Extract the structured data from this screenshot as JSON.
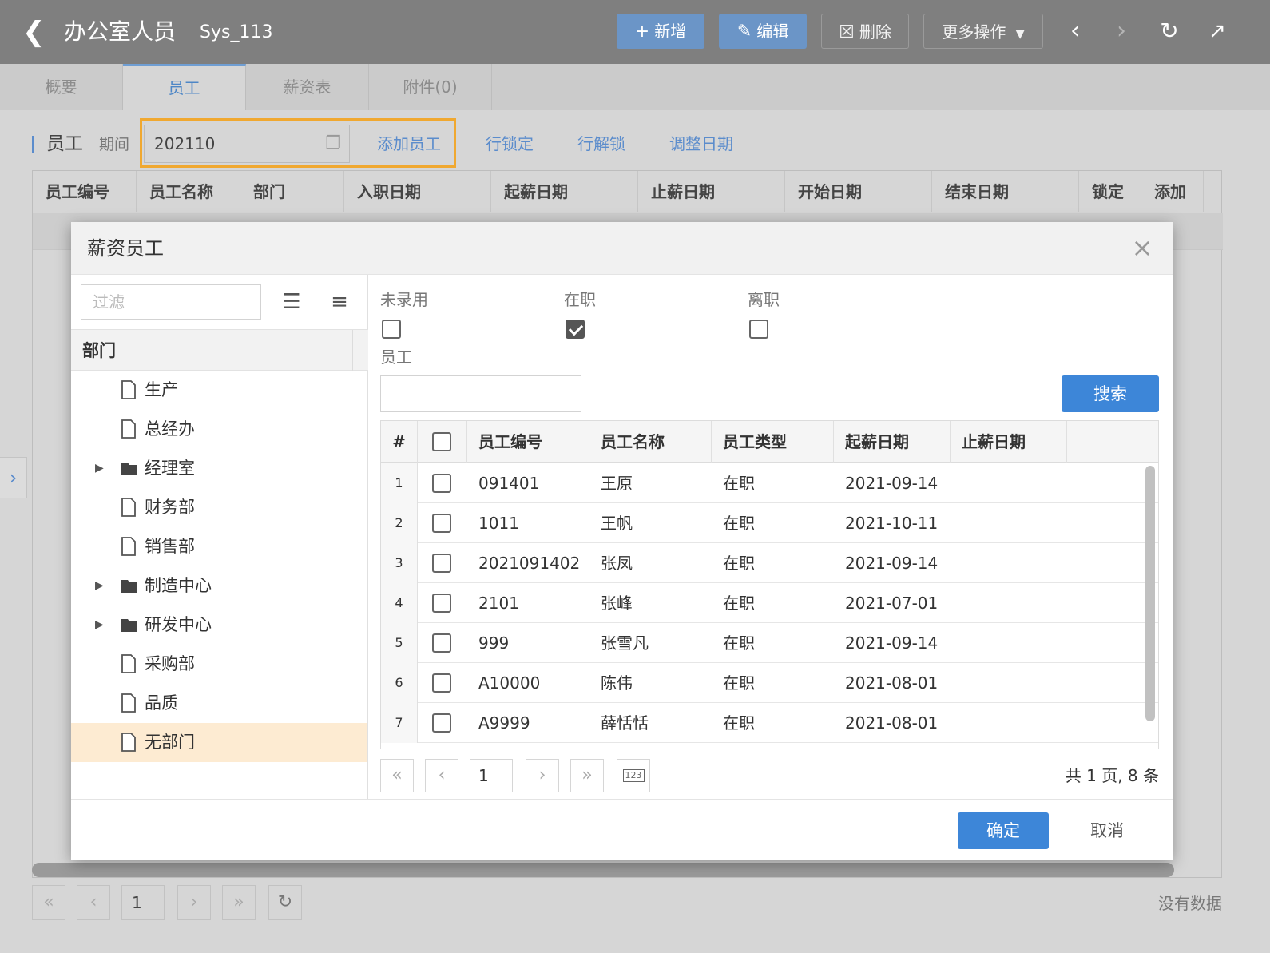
{
  "topbar": {
    "back_icon": "chevron-left-icon",
    "title": "办公室人员",
    "sys_id": "Sys_113",
    "buttons": {
      "add": "新增",
      "edit": "编辑",
      "delete": "删除",
      "more": "更多操作"
    }
  },
  "tabs": [
    {
      "label": "概要"
    },
    {
      "label": "员工",
      "active": true
    },
    {
      "label": "薪资表"
    },
    {
      "label": "附件(0)"
    }
  ],
  "toolbar": {
    "section": "员工",
    "period_label": "期间",
    "period_value": "202110",
    "links": [
      "添加员工",
      "行锁定",
      "行解锁",
      "调整日期"
    ]
  },
  "bg_table": {
    "columns": [
      "员工编号",
      "员工名称",
      "部门",
      "入职日期",
      "起薪日期",
      "止薪日期",
      "开始日期",
      "结束日期",
      "锁定",
      "添加"
    ]
  },
  "bg_pager": {
    "page": "1",
    "status": "没有数据"
  },
  "modal": {
    "title": "薪资员工",
    "filter_placeholder": "过滤",
    "tree_header": "部门",
    "tree": [
      {
        "label": "生产",
        "type": "file"
      },
      {
        "label": "总经办",
        "type": "file"
      },
      {
        "label": "经理室",
        "type": "folder"
      },
      {
        "label": "财务部",
        "type": "file"
      },
      {
        "label": "销售部",
        "type": "file"
      },
      {
        "label": "制造中心",
        "type": "folder"
      },
      {
        "label": "研发中心",
        "type": "folder"
      },
      {
        "label": "采购部",
        "type": "file"
      },
      {
        "label": "品质",
        "type": "file"
      },
      {
        "label": "无部门",
        "type": "file",
        "selected": true
      }
    ],
    "filters": {
      "unhired": {
        "label": "未录用",
        "checked": false
      },
      "active": {
        "label": "在职",
        "checked": true
      },
      "left": {
        "label": "离职",
        "checked": false
      },
      "employee_label": "员工",
      "employee_value": ""
    },
    "search_label": "搜索",
    "grid": {
      "columns": [
        "#",
        "员工编号",
        "员工名称",
        "员工类型",
        "起薪日期",
        "止薪日期"
      ],
      "rows": [
        {
          "num": "1",
          "code": "091401",
          "name": "王原",
          "type": "在职",
          "start": "2021-09-14",
          "end": ""
        },
        {
          "num": "2",
          "code": "1011",
          "name": "王帆",
          "type": "在职",
          "start": "2021-10-11",
          "end": ""
        },
        {
          "num": "3",
          "code": "2021091402",
          "name": "张凤",
          "type": "在职",
          "start": "2021-09-14",
          "end": ""
        },
        {
          "num": "4",
          "code": "2101",
          "name": "张峰",
          "type": "在职",
          "start": "2021-07-01",
          "end": ""
        },
        {
          "num": "5",
          "code": "999",
          "name": "张雪凡",
          "type": "在职",
          "start": "2021-09-14",
          "end": ""
        },
        {
          "num": "6",
          "code": "A10000",
          "name": "陈伟",
          "type": "在职",
          "start": "2021-08-01",
          "end": ""
        },
        {
          "num": "7",
          "code": "A9999",
          "name": "薛恬恬",
          "type": "在职",
          "start": "2021-08-01",
          "end": ""
        }
      ]
    },
    "pager": {
      "page": "1",
      "info": "共 1 页, 8 条"
    },
    "ok_label": "确定",
    "cancel_label": "取消"
  },
  "colors": {
    "accent": "#3d86d8",
    "highlight": "#f0a830",
    "selected_row": "#fdebd2"
  }
}
